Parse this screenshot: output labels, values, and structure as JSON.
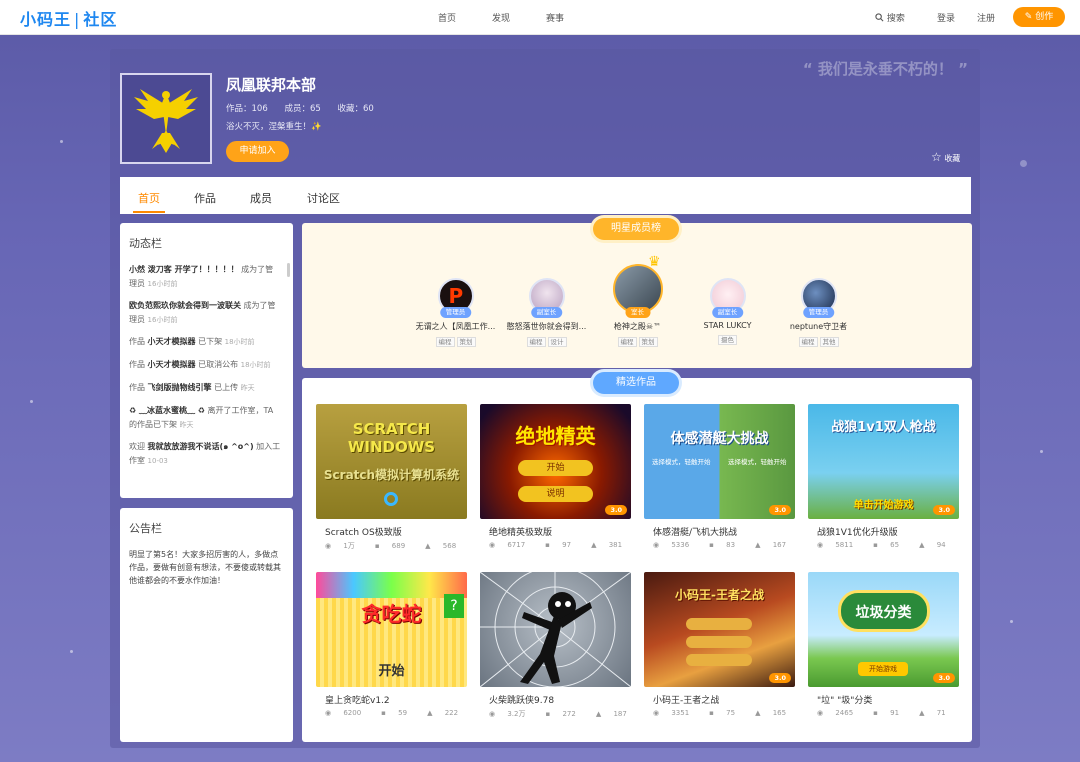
{
  "header": {
    "logo": "小码王",
    "logo_sub": "社区",
    "nav": [
      "首页",
      "发现",
      "赛事"
    ],
    "search": "搜索",
    "login": "登录",
    "register": "注册",
    "create": "创作"
  },
  "clan": {
    "name": "凤凰联邦本部",
    "works": "作品：106",
    "members": "成员：65",
    "favorites": "收藏：60",
    "motto": "浴火不灭，涅槃重生！✨",
    "join": "申请加入",
    "slogan": "“ 我们是永垂不朽的！ ”",
    "favorite": "收藏"
  },
  "tabs": [
    "首页",
    "作品",
    "成员",
    "讨论区"
  ],
  "feed": {
    "title": "动态栏",
    "items": [
      {
        "user": "小然 泼刀客 开学了！！！！！",
        "action": " 成为了管理员",
        "time": "16小时前"
      },
      {
        "user": "欧负范熙玖你就会得到一波联关",
        "action": " 成为了管理员",
        "time": "16小时前"
      },
      {
        "user": "作品 ",
        "bold": "小天才模拟器",
        "action": " 已下架",
        "time": "18小时前"
      },
      {
        "user": "作品 ",
        "bold": "小天才模拟器",
        "action": " 已取消公布",
        "time": "18小时前"
      },
      {
        "user": "作品 ",
        "bold": "飞剑版抛物线引擎",
        "action": " 已上传",
        "time": "昨天"
      },
      {
        "user": "♻︎ ﹏冰蓝水蜜桃﹏ ♻︎",
        "action": " 离开了工作室，TA的作品已下架",
        "time": "昨天"
      },
      {
        "user": "欢迎 ",
        "bold": "我就放放游我不说话(๑ ^o^)",
        "action": " 加入工作室",
        "time": "10-03"
      }
    ]
  },
  "notice": {
    "title": "公告栏",
    "text": "明显了第5名！大家多招厉害的人，多做点作品，要做有创意有想法，不要傻或转载其他谁都会的不要水作加油！"
  },
  "rank": {
    "title": "明星成员榜",
    "members": [
      {
        "name": "无谓之人【凤凰工作...",
        "role": "管理员",
        "tags": [
          "编程",
          "策划"
        ],
        "color": "#2a1a1a",
        "accent": "#ff3a00"
      },
      {
        "name": "憨怒落世你就会得到...",
        "role": "副室长",
        "tags": [
          "编程",
          "设计"
        ],
        "color": "#d8c8d8",
        "accent": "#b070a0"
      },
      {
        "name": "枪神之殿☠™",
        "role": "室长",
        "tags": [
          "编程",
          "策划"
        ],
        "color": "#5a6a78",
        "accent": "#e0e0e0"
      },
      {
        "name": "STAR LUKCY",
        "role": "副室长",
        "tags": [
          "摄色"
        ],
        "color": "#f5dde6",
        "accent": "#e6c070"
      },
      {
        "name": "neptune守卫者",
        "role": "管理员",
        "tags": [
          "编程",
          "其他"
        ],
        "color": "#2d4770",
        "accent": "#6d8fc0"
      }
    ]
  },
  "works": {
    "title": "精选作品",
    "items": [
      {
        "name": "Scratch OS极致版",
        "views": "1万",
        "comments": "689",
        "likes": "568",
        "ver": ""
      },
      {
        "name": "绝地精英极致版",
        "views": "6717",
        "comments": "97",
        "likes": "381",
        "ver": "3.0"
      },
      {
        "name": "体感潜艇/飞机大挑战",
        "views": "5336",
        "comments": "83",
        "likes": "167",
        "ver": "3.0"
      },
      {
        "name": "战狼1V1优化升级版",
        "views": "5811",
        "comments": "65",
        "likes": "94",
        "ver": "3.0"
      },
      {
        "name": "皇上贪吃蛇v1.2",
        "views": "6200",
        "comments": "59",
        "likes": "222",
        "ver": ""
      },
      {
        "name": "火柴跳跃侠9.78",
        "views": "3.2万",
        "comments": "272",
        "likes": "187",
        "ver": ""
      },
      {
        "name": "小码王-王者之战",
        "views": "3351",
        "comments": "75",
        "likes": "165",
        "ver": "3.0"
      },
      {
        "name": "\"垃\" \"圾\"分类",
        "views": "2465",
        "comments": "91",
        "likes": "71",
        "ver": "3.0"
      }
    ]
  },
  "thumbs": {
    "t1a": "SCRATCH WINDOWS",
    "t1b": "Scratch模拟计算机系统",
    "t2a": "绝地精英",
    "t2b": "开始",
    "t2c": "说明",
    "t3a": "体感潜艇大挑战",
    "t3b": "选择模式，轻触开始",
    "t4a": "战狼1v1双人枪战",
    "t4b": "单击开始游戏",
    "t5a": "贪吃蛇",
    "t5b": "开始",
    "t7a": "小码王-王者之战",
    "t8a": "垃圾分类",
    "t8b": "开始游戏"
  }
}
